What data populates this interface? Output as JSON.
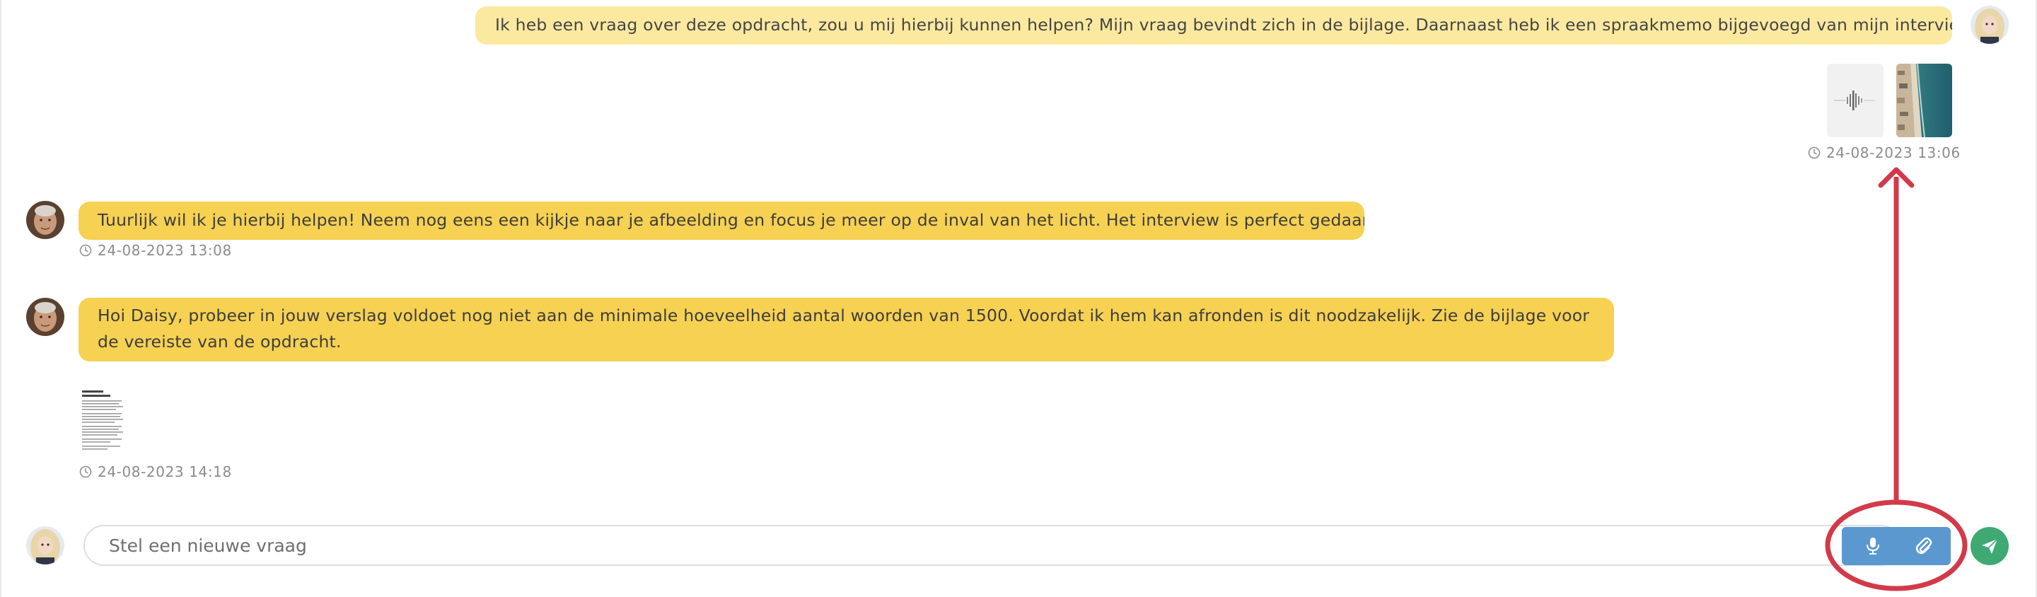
{
  "conversation": {
    "messages": [
      {
        "sender": "student",
        "text": "Ik heb een vraag over deze opdracht, zou u mij hierbij kunnen helpen? Mijn vraag bevindt zich in de bijlage. Daarnaast heb ik een spraakmemo bijgevoegd van mijn interview.",
        "attachments": [
          "audio-memo",
          "beach-photo"
        ],
        "timestamp": "24-08-2023 13:06"
      },
      {
        "sender": "teacher",
        "text": "Tuurlijk wil ik je hierbij helpen! Neem nog eens een kijkje naar je afbeelding en focus je meer op de inval van het licht. Het interview is perfect gedaan!",
        "timestamp": "24-08-2023 13:08"
      },
      {
        "sender": "teacher",
        "text": "Hoi Daisy, probeer in jouw verslag voldoet nog niet aan de minimale hoeveelheid aantal woorden van 1500. Voordat ik hem kan afronden is dit noodzakelijk. Zie de bijlage voor de vereiste van de opdracht.",
        "attachments": [
          "document"
        ],
        "timestamp": "24-08-2023 14:18"
      }
    ]
  },
  "composer": {
    "placeholder": "Stel een nieuwe vraag",
    "value": ""
  },
  "icons": {
    "mic": "microphone-icon",
    "attach": "paperclip-icon",
    "send": "paper-plane-icon",
    "clock": "clock-icon"
  },
  "colors": {
    "student_bubble": "#fbe9a0",
    "teacher_bubble": "#f6d152",
    "tools_button": "#5b98cf",
    "send_button": "#3fa974",
    "annotation": "#d23a4a"
  }
}
